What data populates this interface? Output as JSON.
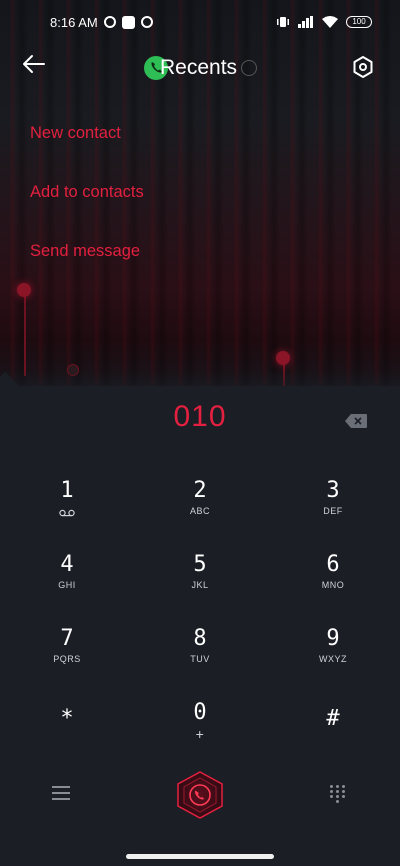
{
  "status": {
    "time": "8:16 AM",
    "battery": "100"
  },
  "header": {
    "title": "Recents",
    "icons": {
      "back": "arrow-left-icon",
      "settings": "hexagon-settings-icon",
      "app": "phone-icon"
    }
  },
  "menu": {
    "items": [
      {
        "label": "New contact"
      },
      {
        "label": "Add to contacts"
      },
      {
        "label": "Send message"
      }
    ]
  },
  "dialer": {
    "number": "010",
    "keys": [
      {
        "digit": "1",
        "letters": "voicemail-icon"
      },
      {
        "digit": "2",
        "letters": "ABC"
      },
      {
        "digit": "3",
        "letters": "DEF"
      },
      {
        "digit": "4",
        "letters": "GHI"
      },
      {
        "digit": "5",
        "letters": "JKL"
      },
      {
        "digit": "6",
        "letters": "MNO"
      },
      {
        "digit": "7",
        "letters": "PQRS"
      },
      {
        "digit": "8",
        "letters": "TUV"
      },
      {
        "digit": "9",
        "letters": "WXYZ"
      },
      {
        "digit": "*",
        "letters": ""
      },
      {
        "digit": "0",
        "letters": "+"
      },
      {
        "digit": "#",
        "letters": ""
      }
    ]
  },
  "colors": {
    "accent": "#e3203f",
    "background": "#1b1e25",
    "phone_badge": "#2fbd55"
  }
}
